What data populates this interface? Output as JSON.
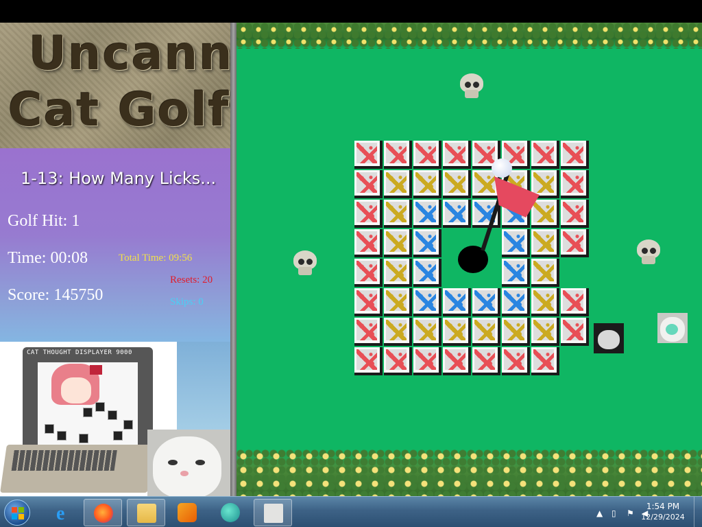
{
  "game": {
    "logo_line1": "Uncanny",
    "logo_line2": "Cat Golf",
    "level_name": "1-13: How Many Licks...",
    "golf_hit": "Golf Hit: 1",
    "time": "Time: 00:08",
    "score": "Score: 145750",
    "total_time": "Total Time: 09:56",
    "resets": "Resets: 20",
    "skips": "Skips: 0",
    "monitor_title": "CAT THOUGHT DISPLAYER 9000"
  },
  "board": {
    "rows": [
      [
        "red",
        "red",
        "red",
        "red",
        "red",
        "red",
        "red",
        "red"
      ],
      [
        "red",
        "yellow",
        "yellow",
        "yellow",
        "yellow",
        "yellow",
        "yellow",
        "red"
      ],
      [
        "red",
        "yellow",
        "blue",
        "blue",
        "blue",
        "blue",
        "yellow",
        "red"
      ],
      [
        "red",
        "yellow",
        "blue",
        "",
        "",
        "blue",
        "yellow",
        "red"
      ],
      [
        "red",
        "yellow",
        "blue",
        "",
        "",
        "blue",
        "yellow",
        ""
      ],
      [
        "red",
        "yellow",
        "blue",
        "blue",
        "blue",
        "blue",
        "yellow",
        "red"
      ],
      [
        "red",
        "yellow",
        "yellow",
        "yellow",
        "yellow",
        "yellow",
        "yellow",
        "red"
      ],
      [
        "red",
        "red",
        "red",
        "red",
        "red",
        "red",
        "red",
        ""
      ]
    ],
    "colors": {
      "red": "#e8464e",
      "yellow": "#c9a616",
      "blue": "#1f7fe0",
      "grass": "#0fb663"
    }
  },
  "taskbar": {
    "apps": [
      "start-icon",
      "internet-explorer-icon",
      "firefox-icon",
      "file-explorer-icon",
      "media-player-icon",
      "chat-app-icon",
      "cat-golf-icon"
    ],
    "clock_time": "1:54 PM",
    "clock_date": "12/29/2024"
  }
}
